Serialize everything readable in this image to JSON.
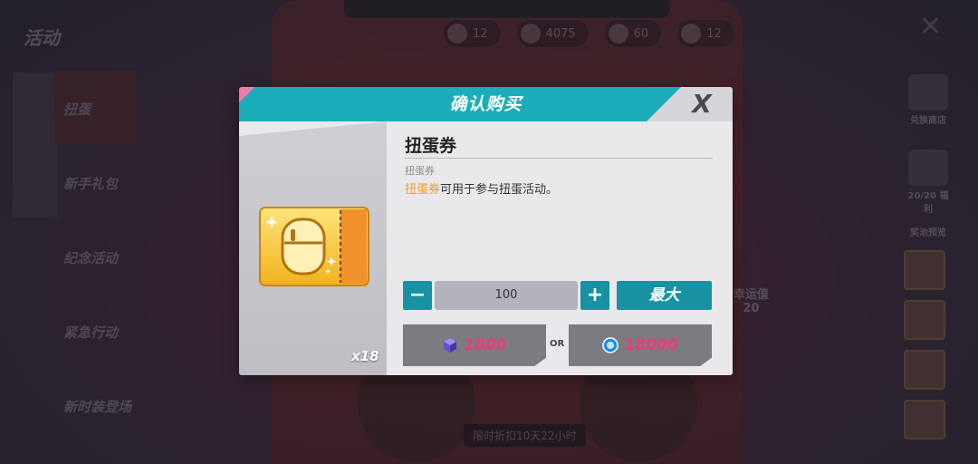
{
  "background": {
    "activity_title": "活动",
    "nav_items": [
      "扭蛋",
      "新手礼包",
      "纪念活动",
      "紧急行动",
      "新时装登场"
    ],
    "resources": [
      {
        "icon": "ticket-icon",
        "value": "12"
      },
      {
        "icon": "coin-icon",
        "value": "4075"
      },
      {
        "icon": "gem-icon",
        "value": "60"
      },
      {
        "icon": "cube-icon",
        "value": "12"
      }
    ],
    "right_buttons": [
      "兑换商店",
      "20/20 福利",
      "奖池预览"
    ],
    "luck_label": "幸运值",
    "luck_value": "20",
    "timer": "限时折扣10天22小时"
  },
  "dialog": {
    "title": "确认购买",
    "close_label": "X",
    "item": {
      "name": "扭蛋券",
      "subtitle": "扭蛋券",
      "desc_highlight": "扭蛋券",
      "desc_rest": "可用于参与扭蛋活动。",
      "count": "x18"
    },
    "quantity": {
      "minus_label": "−",
      "value": "100",
      "plus_label": "+",
      "max_label": "最大"
    },
    "purchase": {
      "or_label": "OR",
      "option_a": {
        "icon": "purple-cube-icon",
        "price": "1800"
      },
      "option_b": {
        "icon": "blue-gem-icon",
        "price": "18000"
      }
    }
  },
  "colors": {
    "header": "#1cadbb",
    "accent_pink": "#f27aa8",
    "button_teal": "#1891a3",
    "price_pink": "#f0387a",
    "highlight_orange": "#f39a1c"
  }
}
